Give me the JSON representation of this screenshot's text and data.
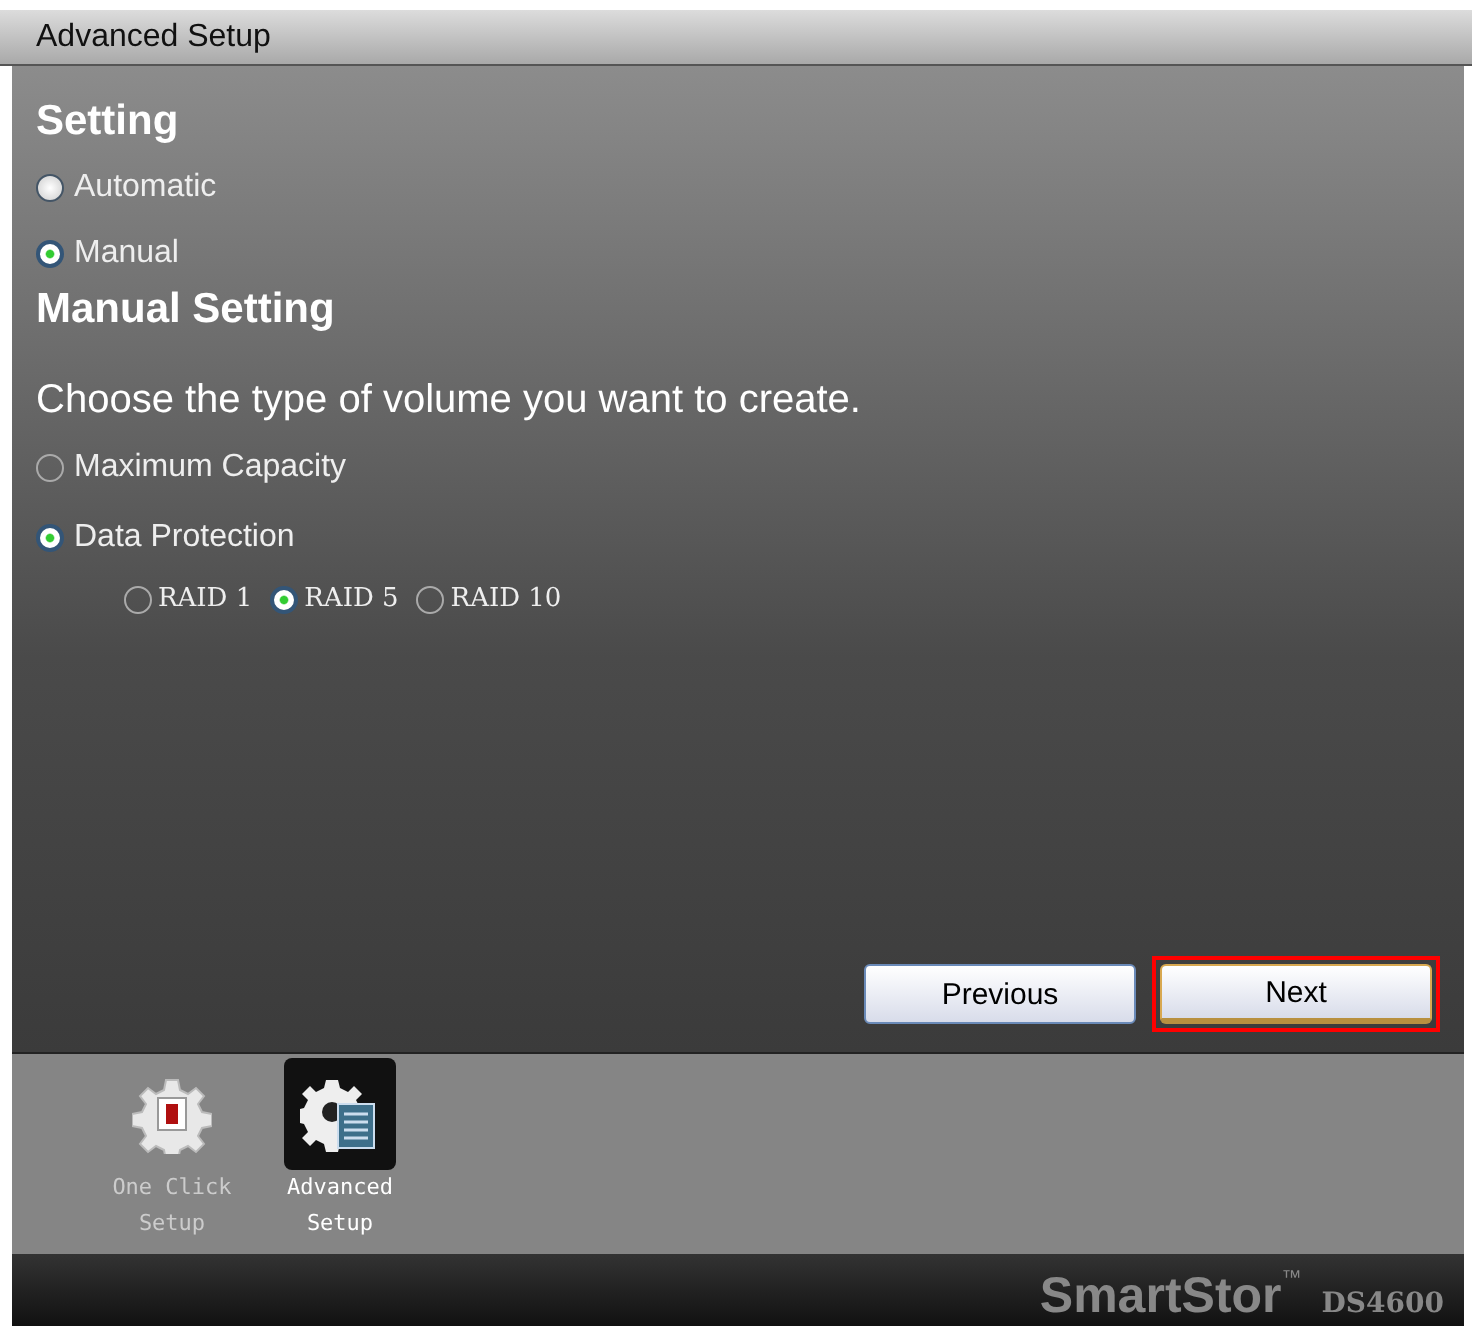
{
  "window": {
    "title": "Advanced Setup"
  },
  "setting": {
    "heading": "Setting",
    "options": [
      {
        "label": "Automatic",
        "selected": false
      },
      {
        "label": "Manual",
        "selected": true
      }
    ]
  },
  "manual": {
    "heading": "Manual Setting",
    "prompt": "Choose the type of volume you want to create.",
    "volume_types": [
      {
        "label": "Maximum Capacity",
        "selected": false
      },
      {
        "label": "Data Protection",
        "selected": true
      }
    ],
    "raid_levels": [
      {
        "label": "RAID 1",
        "selected": false
      },
      {
        "label": "RAID 5",
        "selected": true
      },
      {
        "label": "RAID 10",
        "selected": false
      }
    ]
  },
  "buttons": [
    {
      "label": "Previous",
      "highlighted": false
    },
    {
      "label": "Next",
      "highlighted": true
    }
  ],
  "dock": [
    {
      "label": "One Click Setup",
      "kind": "oneclick",
      "selected": false
    },
    {
      "label": "Advanced Setup",
      "kind": "advanced",
      "selected": true
    }
  ],
  "brand": {
    "name": "SmartStor",
    "mark": "™",
    "model": "DS4600"
  }
}
